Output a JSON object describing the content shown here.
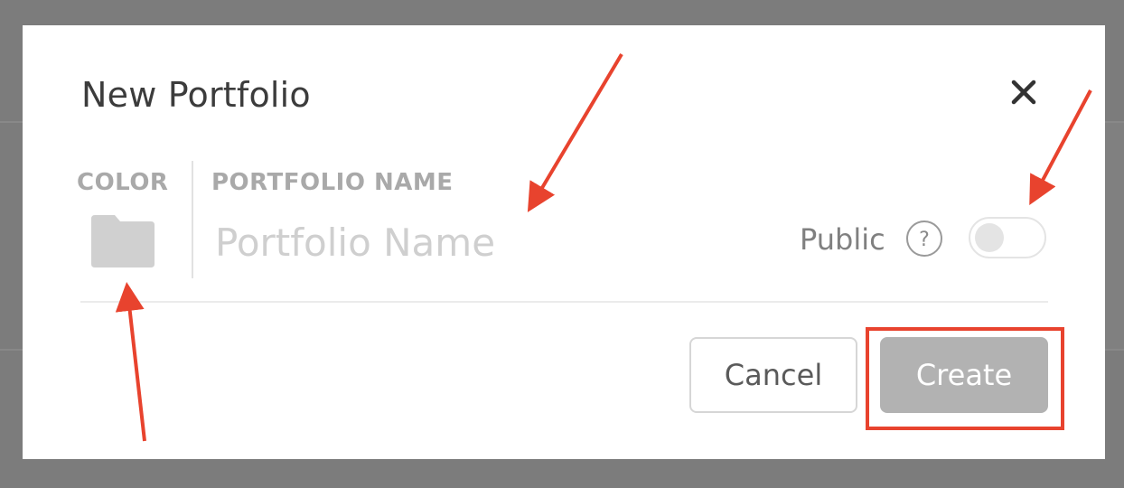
{
  "modal": {
    "title": "New Portfolio",
    "close_icon": "close-icon"
  },
  "color": {
    "label": "COLOR",
    "icon": "folder-icon",
    "swatch_color": "#d0d0d0"
  },
  "portfolio_name": {
    "label": "PORTFOLIO NAME",
    "placeholder": "Portfolio Name",
    "value": ""
  },
  "visibility": {
    "label": "Public",
    "help_icon": "question-circle-icon",
    "toggle_on": false
  },
  "actions": {
    "cancel_label": "Cancel",
    "create_label": "Create"
  },
  "colors": {
    "accent_annotation": "#e8432e",
    "create_disabled": "#b2b2b2"
  }
}
